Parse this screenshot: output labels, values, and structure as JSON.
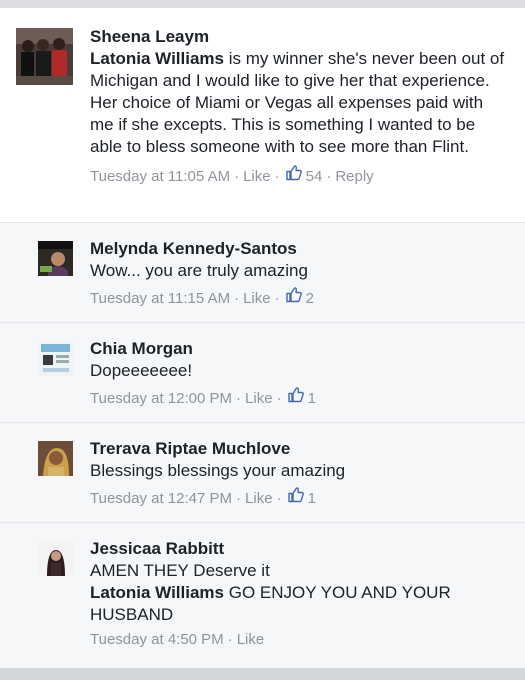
{
  "comments": [
    {
      "author": "Sheena Leaym",
      "mention": "Latonia Williams",
      "text": "is my winner she's never been out of Michigan and I would like to give her that experience. Her choice of Miami or Vegas all expenses paid with me  if she excepts. This is something I wanted to be able to bless someone with  to see more than Flint.",
      "time": "Tuesday at 11:05 AM",
      "like_label": "Like",
      "reactions": "54",
      "reply_label": "Reply"
    },
    {
      "author": "Melynda Kennedy-Santos",
      "text": "Wow... you are truly amazing",
      "time": "Tuesday at 11:15 AM",
      "like_label": "Like",
      "reactions": "2"
    },
    {
      "author": "Chia Morgan",
      "text": "Dopeeeeeee!",
      "time": "Tuesday at 12:00 PM",
      "like_label": "Like",
      "reactions": "1"
    },
    {
      "author": "Trerava Riptae Muchlove",
      "text": "Blessings blessings your amazing",
      "time": "Tuesday at 12:47 PM",
      "like_label": "Like",
      "reactions": "1"
    },
    {
      "author": "Jessicaa Rabbitt",
      "text": "AMEN THEY Deserve it",
      "mention": "Latonia Williams",
      "text2": "GO ENJOY YOU AND YOUR HUSBAND",
      "time": "Tuesday at 4:50 PM",
      "like_label": "Like"
    }
  ],
  "separator": "·",
  "icons": [
    "thumbs-up-icon"
  ],
  "colors": {
    "name": "#1d2129",
    "meta": "#90949c",
    "like_blue": "#4267b2",
    "reply_bg": "#f6f7f9"
  }
}
